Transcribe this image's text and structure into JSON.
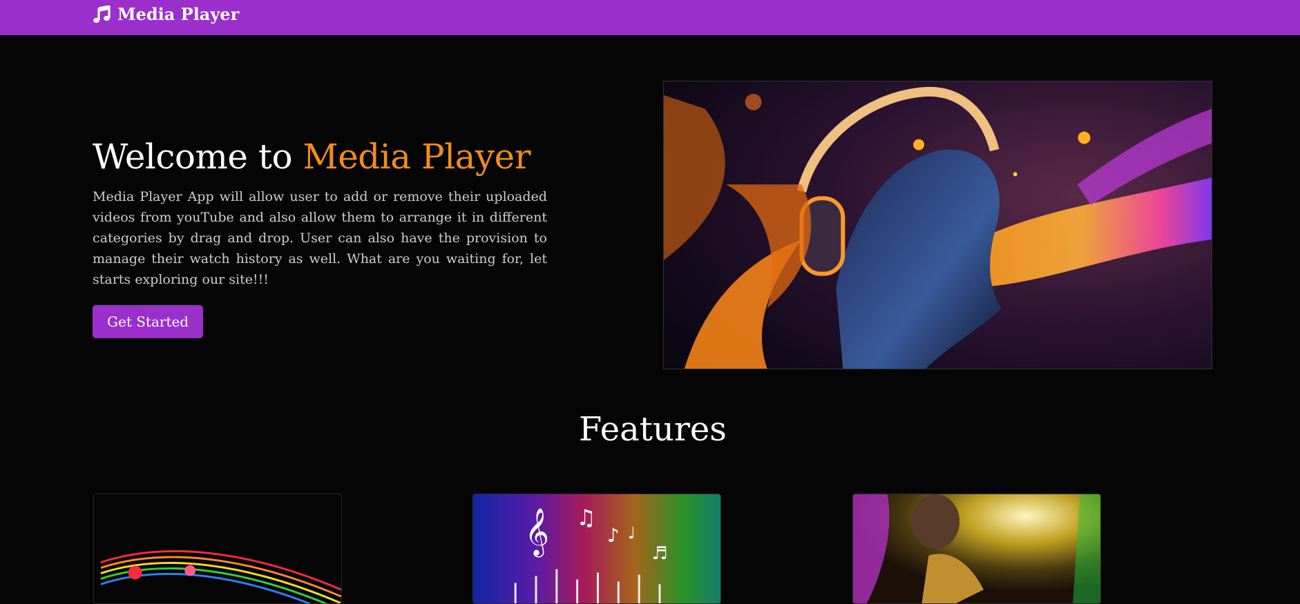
{
  "navbar": {
    "brand_icon": "music-note-icon",
    "brand_label": "Media Player",
    "background": "#9a2fcb"
  },
  "hero": {
    "title_prefix": "Welcome to",
    "title_accent": "Media Player",
    "accent_color": "#f08d1a",
    "description": "Media Player App will allow user to add or remove their uploaded videos from youTube and also allow them to arrange it in different categories by drag and drop. User can also have the provision to manage their watch history as well. What are you waiting for, let starts exploring our site!!!",
    "cta_label": "Get Started"
  },
  "features": {
    "title": "Features",
    "cards": [
      {
        "image": "rainbow-music-notes-image"
      },
      {
        "image": "colorful-equalizer-notes-image"
      },
      {
        "image": "saxophone-player-image"
      }
    ]
  }
}
